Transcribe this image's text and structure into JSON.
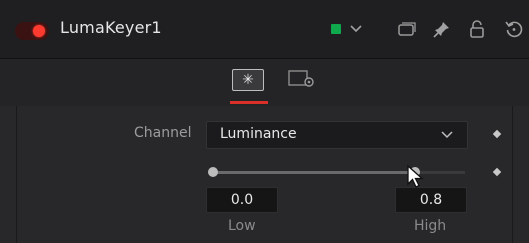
{
  "node": {
    "title": "LumaKeyer1",
    "enabled_color": "#ff3b30",
    "tile_color": "#10a84c"
  },
  "header_icons": [
    "color-swatch-icon",
    "chevron-down-icon",
    "window-icon",
    "pin-icon",
    "lock-icon",
    "reset-icon"
  ],
  "tabs": [
    {
      "name": "controls",
      "icon": "sparkle-icon",
      "active": true
    },
    {
      "name": "settings",
      "icon": "settings-icon",
      "active": false
    }
  ],
  "controls": {
    "channel": {
      "label": "Channel",
      "value": "Luminance"
    },
    "range": {
      "low": {
        "value": "0.0",
        "label": "Low"
      },
      "high": {
        "value": "0.8",
        "label": "High"
      },
      "low_fraction": 0.0,
      "high_fraction": 0.8
    }
  }
}
